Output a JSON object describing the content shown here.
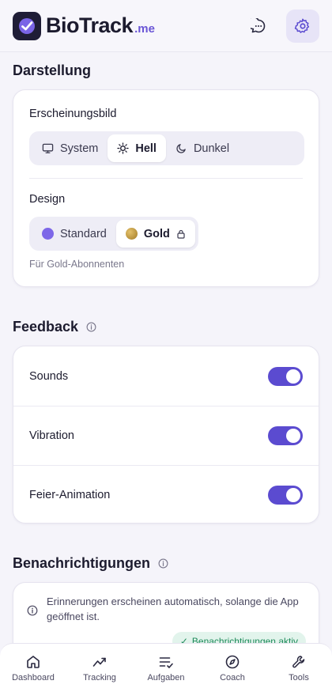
{
  "header": {
    "brand_main": "BioTrack",
    "brand_suffix": ".me",
    "icons": [
      "logo-icon",
      "chat-icon",
      "settings-icon"
    ]
  },
  "darstellung": {
    "title": "Darstellung",
    "appearance_label": "Erscheinungsbild",
    "appearance_options": [
      {
        "label": "System",
        "icon": "monitor-icon",
        "selected": false
      },
      {
        "label": "Hell",
        "icon": "sun-icon",
        "selected": true
      },
      {
        "label": "Dunkel",
        "icon": "moon-icon",
        "selected": false
      }
    ],
    "design_label": "Design",
    "design_options": [
      {
        "label": "Standard",
        "color": "#7d67e8",
        "selected": false
      },
      {
        "label": "Gold",
        "color": "#c89b3c",
        "selected": true,
        "locked": true
      }
    ],
    "design_hint": "Für Gold-Abonnenten"
  },
  "feedback": {
    "title": "Feedback",
    "rows": [
      {
        "label": "Sounds",
        "enabled": true
      },
      {
        "label": "Vibration",
        "enabled": true
      },
      {
        "label": "Feier-Animation",
        "enabled": true
      }
    ]
  },
  "notifications": {
    "title": "Benachrichtigungen",
    "info": "Erinnerungen erscheinen automatisch, solange die App geöffnet ist.",
    "badge": "Benachrichtigungen aktiv"
  },
  "bottom_nav": [
    {
      "label": "Dashboard",
      "icon": "home-icon"
    },
    {
      "label": "Tracking",
      "icon": "trend-icon"
    },
    {
      "label": "Aufgaben",
      "icon": "task-list-icon"
    },
    {
      "label": "Coach",
      "icon": "compass-icon"
    },
    {
      "label": "Tools",
      "icon": "wrench-icon"
    }
  ],
  "colors": {
    "accent": "#5b4bd0",
    "gold": "#c89b3c",
    "success": "#1e8a5a"
  }
}
